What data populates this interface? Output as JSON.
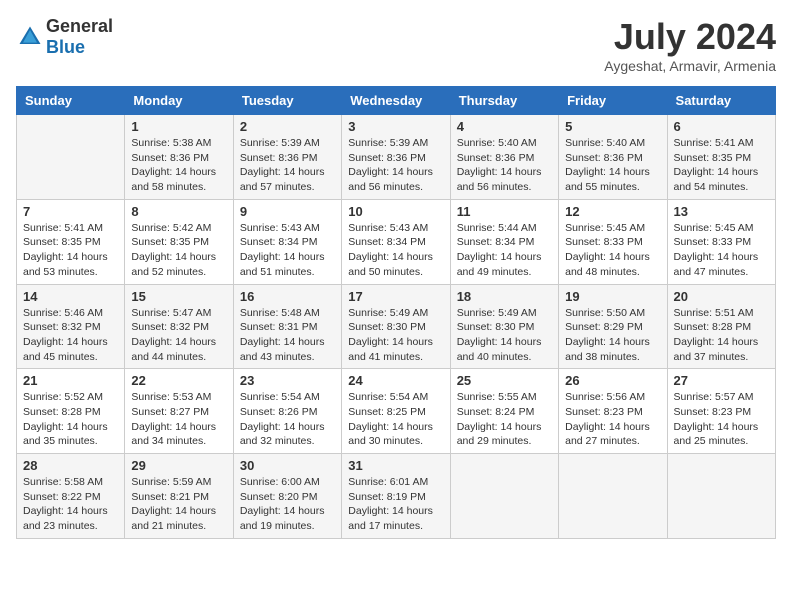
{
  "header": {
    "logo_general": "General",
    "logo_blue": "Blue",
    "month_year": "July 2024",
    "location": "Aygeshat, Armavir, Armenia"
  },
  "calendar": {
    "days_of_week": [
      "Sunday",
      "Monday",
      "Tuesday",
      "Wednesday",
      "Thursday",
      "Friday",
      "Saturday"
    ],
    "weeks": [
      [
        {
          "day": "",
          "info": ""
        },
        {
          "day": "1",
          "info": "Sunrise: 5:38 AM\nSunset: 8:36 PM\nDaylight: 14 hours\nand 58 minutes."
        },
        {
          "day": "2",
          "info": "Sunrise: 5:39 AM\nSunset: 8:36 PM\nDaylight: 14 hours\nand 57 minutes."
        },
        {
          "day": "3",
          "info": "Sunrise: 5:39 AM\nSunset: 8:36 PM\nDaylight: 14 hours\nand 56 minutes."
        },
        {
          "day": "4",
          "info": "Sunrise: 5:40 AM\nSunset: 8:36 PM\nDaylight: 14 hours\nand 56 minutes."
        },
        {
          "day": "5",
          "info": "Sunrise: 5:40 AM\nSunset: 8:36 PM\nDaylight: 14 hours\nand 55 minutes."
        },
        {
          "day": "6",
          "info": "Sunrise: 5:41 AM\nSunset: 8:35 PM\nDaylight: 14 hours\nand 54 minutes."
        }
      ],
      [
        {
          "day": "7",
          "info": "Sunrise: 5:41 AM\nSunset: 8:35 PM\nDaylight: 14 hours\nand 53 minutes."
        },
        {
          "day": "8",
          "info": "Sunrise: 5:42 AM\nSunset: 8:35 PM\nDaylight: 14 hours\nand 52 minutes."
        },
        {
          "day": "9",
          "info": "Sunrise: 5:43 AM\nSunset: 8:34 PM\nDaylight: 14 hours\nand 51 minutes."
        },
        {
          "day": "10",
          "info": "Sunrise: 5:43 AM\nSunset: 8:34 PM\nDaylight: 14 hours\nand 50 minutes."
        },
        {
          "day": "11",
          "info": "Sunrise: 5:44 AM\nSunset: 8:34 PM\nDaylight: 14 hours\nand 49 minutes."
        },
        {
          "day": "12",
          "info": "Sunrise: 5:45 AM\nSunset: 8:33 PM\nDaylight: 14 hours\nand 48 minutes."
        },
        {
          "day": "13",
          "info": "Sunrise: 5:45 AM\nSunset: 8:33 PM\nDaylight: 14 hours\nand 47 minutes."
        }
      ],
      [
        {
          "day": "14",
          "info": "Sunrise: 5:46 AM\nSunset: 8:32 PM\nDaylight: 14 hours\nand 45 minutes."
        },
        {
          "day": "15",
          "info": "Sunrise: 5:47 AM\nSunset: 8:32 PM\nDaylight: 14 hours\nand 44 minutes."
        },
        {
          "day": "16",
          "info": "Sunrise: 5:48 AM\nSunset: 8:31 PM\nDaylight: 14 hours\nand 43 minutes."
        },
        {
          "day": "17",
          "info": "Sunrise: 5:49 AM\nSunset: 8:30 PM\nDaylight: 14 hours\nand 41 minutes."
        },
        {
          "day": "18",
          "info": "Sunrise: 5:49 AM\nSunset: 8:30 PM\nDaylight: 14 hours\nand 40 minutes."
        },
        {
          "day": "19",
          "info": "Sunrise: 5:50 AM\nSunset: 8:29 PM\nDaylight: 14 hours\nand 38 minutes."
        },
        {
          "day": "20",
          "info": "Sunrise: 5:51 AM\nSunset: 8:28 PM\nDaylight: 14 hours\nand 37 minutes."
        }
      ],
      [
        {
          "day": "21",
          "info": "Sunrise: 5:52 AM\nSunset: 8:28 PM\nDaylight: 14 hours\nand 35 minutes."
        },
        {
          "day": "22",
          "info": "Sunrise: 5:53 AM\nSunset: 8:27 PM\nDaylight: 14 hours\nand 34 minutes."
        },
        {
          "day": "23",
          "info": "Sunrise: 5:54 AM\nSunset: 8:26 PM\nDaylight: 14 hours\nand 32 minutes."
        },
        {
          "day": "24",
          "info": "Sunrise: 5:54 AM\nSunset: 8:25 PM\nDaylight: 14 hours\nand 30 minutes."
        },
        {
          "day": "25",
          "info": "Sunrise: 5:55 AM\nSunset: 8:24 PM\nDaylight: 14 hours\nand 29 minutes."
        },
        {
          "day": "26",
          "info": "Sunrise: 5:56 AM\nSunset: 8:23 PM\nDaylight: 14 hours\nand 27 minutes."
        },
        {
          "day": "27",
          "info": "Sunrise: 5:57 AM\nSunset: 8:23 PM\nDaylight: 14 hours\nand 25 minutes."
        }
      ],
      [
        {
          "day": "28",
          "info": "Sunrise: 5:58 AM\nSunset: 8:22 PM\nDaylight: 14 hours\nand 23 minutes."
        },
        {
          "day": "29",
          "info": "Sunrise: 5:59 AM\nSunset: 8:21 PM\nDaylight: 14 hours\nand 21 minutes."
        },
        {
          "day": "30",
          "info": "Sunrise: 6:00 AM\nSunset: 8:20 PM\nDaylight: 14 hours\nand 19 minutes."
        },
        {
          "day": "31",
          "info": "Sunrise: 6:01 AM\nSunset: 8:19 PM\nDaylight: 14 hours\nand 17 minutes."
        },
        {
          "day": "",
          "info": ""
        },
        {
          "day": "",
          "info": ""
        },
        {
          "day": "",
          "info": ""
        }
      ]
    ]
  }
}
